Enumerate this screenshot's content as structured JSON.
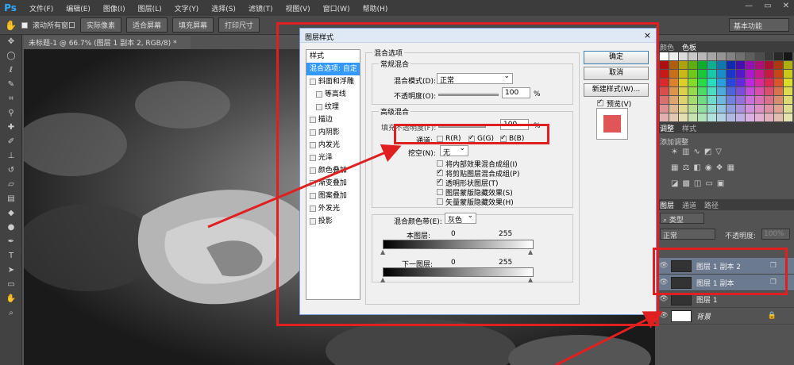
{
  "menubar": {
    "logo": "Ps",
    "items": [
      "文件(F)",
      "编辑(E)",
      "图像(I)",
      "图层(L)",
      "文字(Y)",
      "选择(S)",
      "滤镜(T)",
      "视图(V)",
      "窗口(W)",
      "帮助(H)"
    ]
  },
  "options": {
    "scroll_all": "滚动所有窗口",
    "buttons": [
      "实际像素",
      "适合屏幕",
      "填充屏幕",
      "打印尺寸"
    ],
    "workspace": "基本功能"
  },
  "document": {
    "tab": "未标题-1 @ 66.7% (图层 1 副本 2, RGB/8) *"
  },
  "right_panel": {
    "swatches_tabs": [
      "颜色",
      "色板"
    ],
    "adj_tabs": [
      "调整",
      "样式"
    ],
    "adj_title": "添加调整",
    "layers_tabs": [
      "图层",
      "通道",
      "路径"
    ],
    "kind": "类型",
    "blend": "正常",
    "opacity_label": "不透明度:",
    "opacity": "100%",
    "layers": [
      "图层 1 副本 2",
      "图层 1 副本",
      "图层 1",
      "背景"
    ]
  },
  "dialog": {
    "title": "图层样式",
    "close": "×",
    "styles_header": "样式",
    "styles": [
      "混合选项: 自定",
      "斜面和浮雕",
      "等高线",
      "纹理",
      "描边",
      "内阴影",
      "内发光",
      "光泽",
      "颜色叠加",
      "渐变叠加",
      "图案叠加",
      "外发光",
      "投影"
    ],
    "blending_options": "混合选项",
    "general": "常规混合",
    "blend_mode_label": "混合模式(D):",
    "blend_mode": "正常",
    "opacity_label": "不透明度(O):",
    "opacity_value": "100",
    "percent": "%",
    "advanced": "高级混合",
    "fill_label": "填充不透明度(F):",
    "fill_value": "100",
    "channels_label": "通道:",
    "channel_r": "R(R)",
    "channel_g": "G(G)",
    "channel_b": "B(B)",
    "knockout_label": "挖空(N):",
    "knockout": "无",
    "options": [
      "将内部效果混合成组(I)",
      "将剪贴图层混合成组(P)",
      "透明形状图层(T)",
      "图层蒙版隐藏效果(S)",
      "矢量蒙版隐藏效果(H)"
    ],
    "blend_if_label": "混合颜色带(E):",
    "blend_if": "灰色",
    "this_layer": "本图层:",
    "underlying": "下一图层:",
    "min": "0",
    "max": "255",
    "ok": "确定",
    "cancel": "取消",
    "new_style": "新建样式(W)...",
    "preview": "预览(V)"
  },
  "colors": {
    "highlight": "#e02020",
    "selection": "#3399ff"
  }
}
